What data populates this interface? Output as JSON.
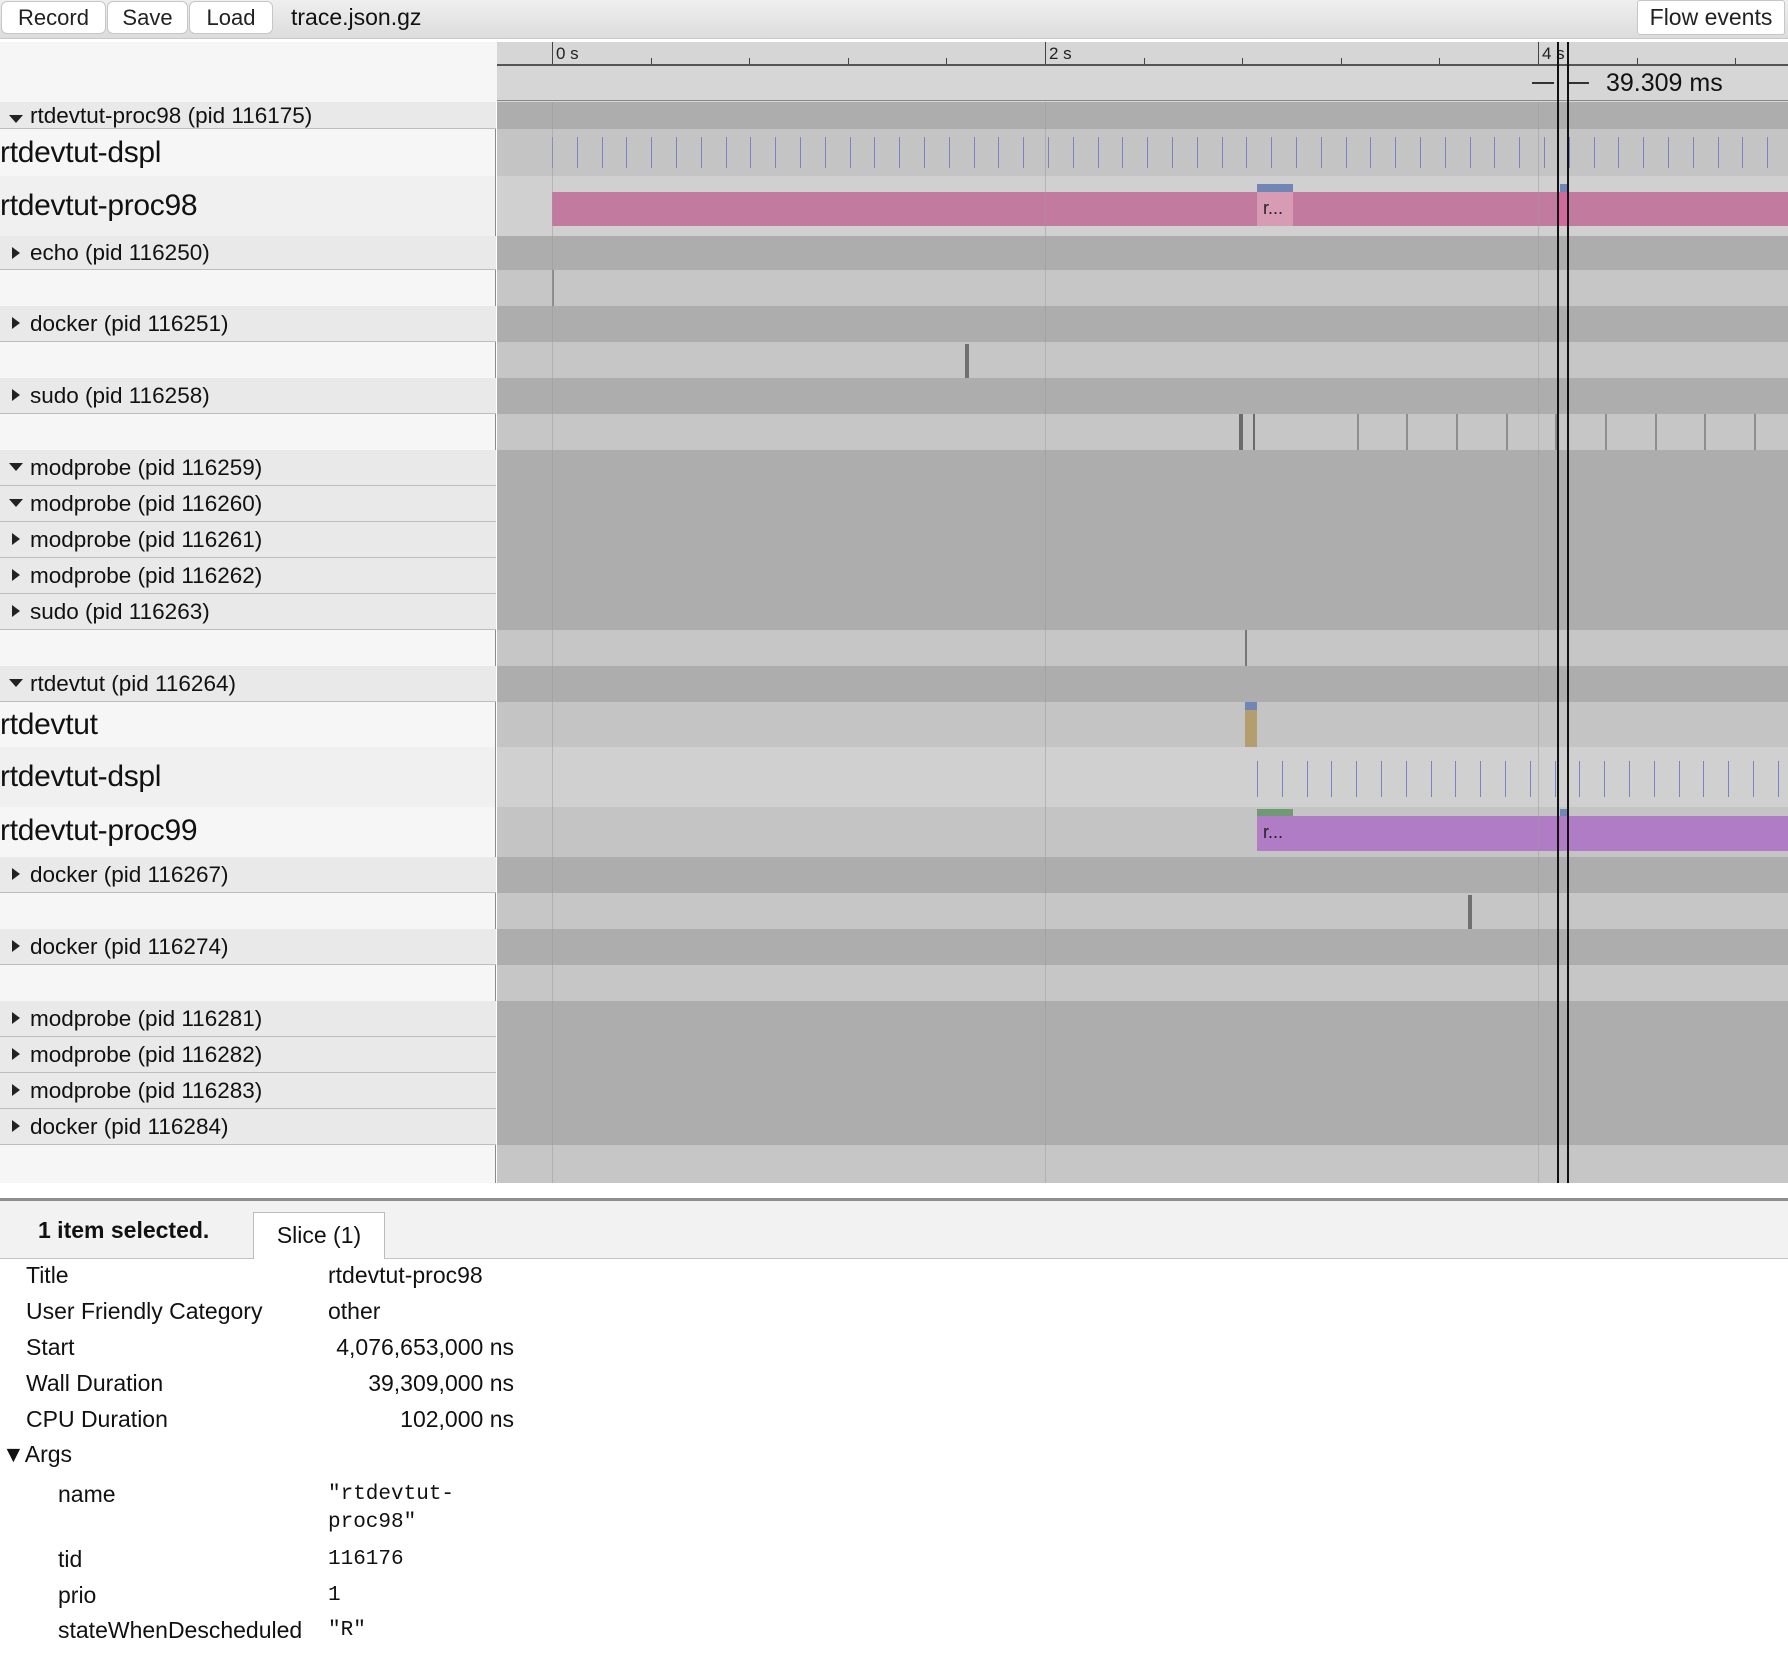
{
  "toolbar": {
    "record_label": "Record",
    "save_label": "Save",
    "load_label": "Load",
    "filename": "trace.json.gz",
    "flow_events_label": "Flow events"
  },
  "ruler": {
    "ticks": [
      {
        "label": "0 s"
      },
      {
        "label": "2 s"
      },
      {
        "label": "4 s"
      }
    ],
    "selection_duration": "39.309 ms"
  },
  "tracks": {
    "proc_116175": "rtdevtut-proc98 (pid 116175)",
    "thread_dspl_1": "rtdevtut-dspl",
    "thread_proc98": "rtdevtut-proc98",
    "slice_proc98_label": "r...",
    "proc_116250": "echo (pid 116250)",
    "proc_116251": "docker (pid 116251)",
    "proc_116258": "sudo (pid 116258)",
    "proc_116259": "modprobe (pid 116259)",
    "proc_116260": "modprobe (pid 116260)",
    "proc_116261": "modprobe (pid 116261)",
    "proc_116262": "modprobe (pid 116262)",
    "proc_116263": "sudo (pid 116263)",
    "proc_116264": "rtdevtut (pid 116264)",
    "thread_rtdevtut": "rtdevtut",
    "thread_dspl_2": "rtdevtut-dspl",
    "thread_proc99": "rtdevtut-proc99",
    "slice_proc99_label": "r...",
    "proc_116267": "docker (pid 116267)",
    "proc_116274": "docker (pid 116274)",
    "proc_116281": "modprobe (pid 116281)",
    "proc_116282": "modprobe (pid 116282)",
    "proc_116283": "modprobe (pid 116283)",
    "proc_116284": "docker (pid 116284)"
  },
  "colors": {
    "proc98_slice": "#c27b9e",
    "proc99_slice": "#b07cc6",
    "selected_slice": "#d06a98",
    "marker": "#7b82c6"
  },
  "detail": {
    "selection_count": "1 item selected.",
    "tab_label": "Slice (1)",
    "rows": {
      "title_key": "Title",
      "title_val": "rtdevtut-proc98",
      "category_key": "User Friendly Category",
      "category_val": "other",
      "start_key": "Start",
      "start_val": "4,076,653,000 ns",
      "wall_key": "Wall Duration",
      "wall_val": "39,309,000 ns",
      "cpu_key": "CPU Duration",
      "cpu_val": "102,000 ns"
    },
    "args_title": "▼Args",
    "args": {
      "name_key": "name",
      "name_val_1": "\"rtdevtut-",
      "name_val_2": "proc98\"",
      "tid_key": "tid",
      "tid_val": "116176",
      "prio_key": "prio",
      "prio_val": "1",
      "state_key": "stateWhenDescheduled",
      "state_val": "\"R\""
    }
  }
}
